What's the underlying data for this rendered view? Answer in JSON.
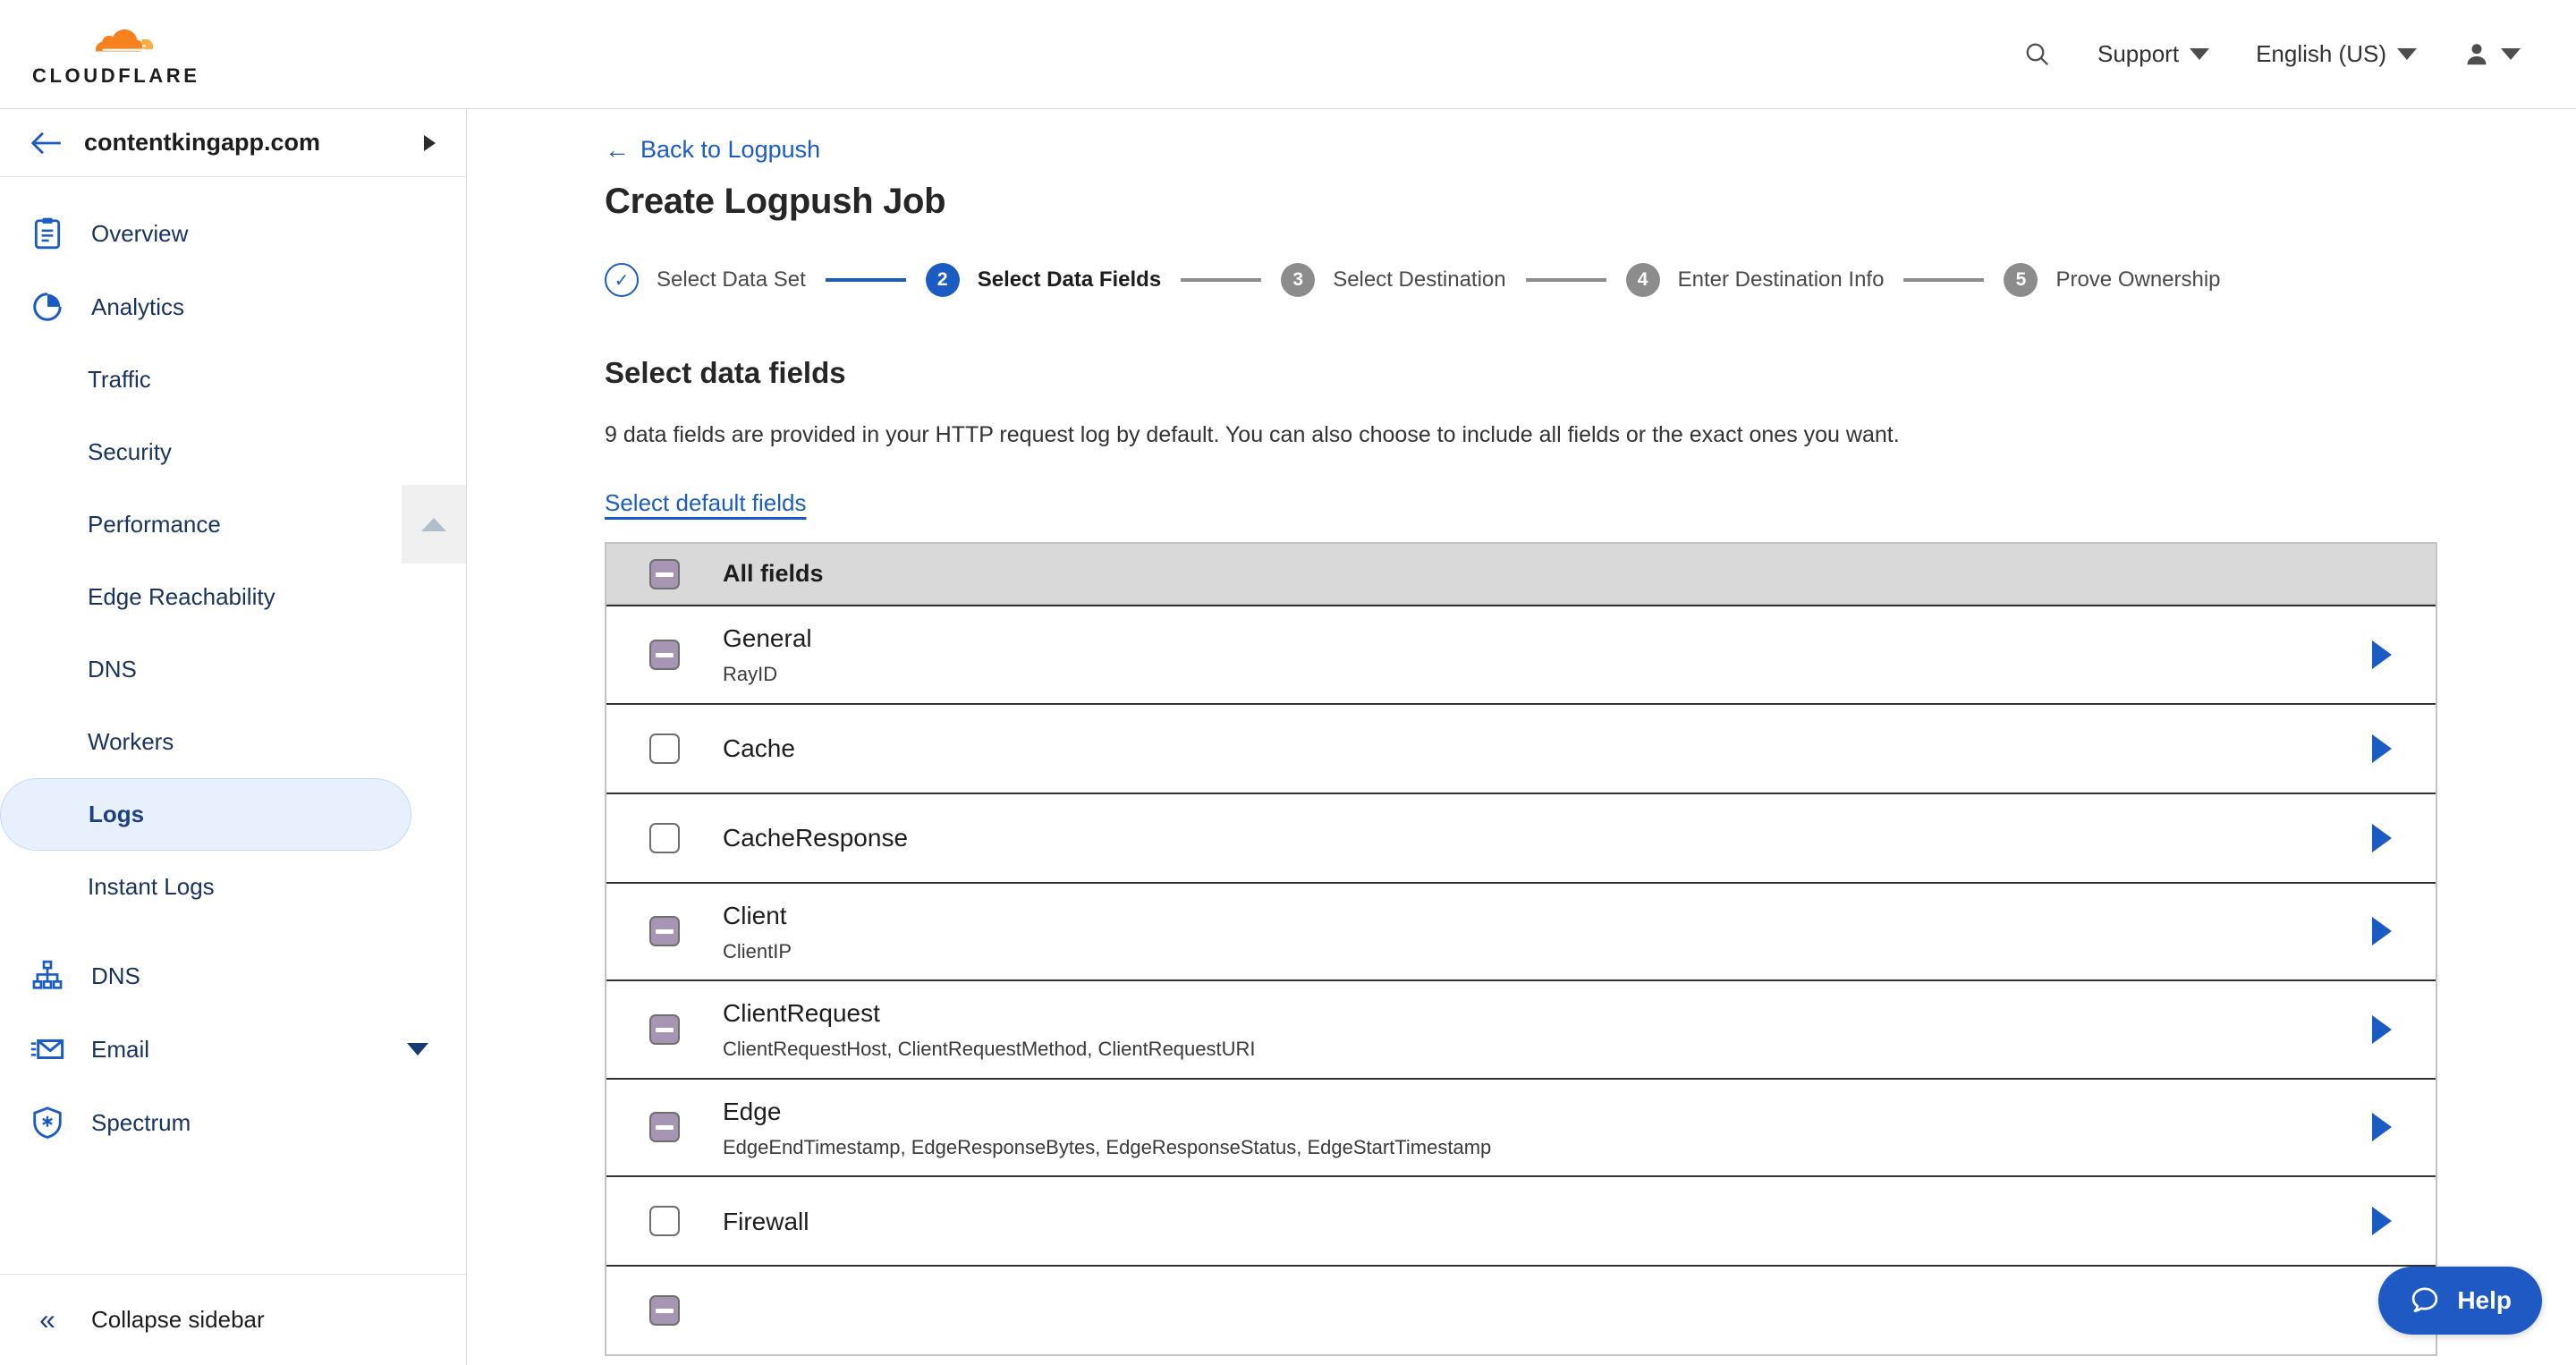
{
  "topbar": {
    "logo_text": "CLOUDFLARE",
    "search_icon": "search-icon",
    "support_label": "Support",
    "language_label": "English (US)",
    "account_icon": "user-icon"
  },
  "sidebar": {
    "zone_name": "contentkingapp.com",
    "back_icon": "back-arrow-icon",
    "items": [
      {
        "label": "Overview",
        "icon": "clipboard-icon",
        "type": "top"
      },
      {
        "label": "Analytics",
        "icon": "pie-chart-icon",
        "type": "top",
        "expanded": true
      },
      {
        "label": "Traffic",
        "type": "sub"
      },
      {
        "label": "Security",
        "type": "sub"
      },
      {
        "label": "Performance",
        "type": "sub"
      },
      {
        "label": "Edge Reachability",
        "type": "sub"
      },
      {
        "label": "DNS",
        "type": "sub"
      },
      {
        "label": "Workers",
        "type": "sub"
      },
      {
        "label": "Logs",
        "type": "sub",
        "active": true
      },
      {
        "label": "Instant Logs",
        "type": "sub"
      },
      {
        "label": "DNS",
        "icon": "sitemap-icon",
        "type": "top"
      },
      {
        "label": "Email",
        "icon": "envelope-icon",
        "type": "top",
        "has_caret": true
      },
      {
        "label": "Spectrum",
        "icon": "shield-icon",
        "type": "top"
      }
    ],
    "collapse_label": "Collapse sidebar"
  },
  "main": {
    "back_link": "Back to Logpush",
    "page_title": "Create Logpush Job",
    "steps": [
      {
        "num": "✓",
        "label": "Select Data Set",
        "state": "done"
      },
      {
        "num": "2",
        "label": "Select Data Fields",
        "state": "current"
      },
      {
        "num": "3",
        "label": "Select Destination",
        "state": "todo"
      },
      {
        "num": "4",
        "label": "Enter Destination Info",
        "state": "todo"
      },
      {
        "num": "5",
        "label": "Prove Ownership",
        "state": "todo"
      }
    ],
    "section_title": "Select data fields",
    "section_desc": "9 data fields are provided in your HTTP request log by default. You can also choose to include all fields or the exact ones you want.",
    "default_fields_link": "Select default fields",
    "table": {
      "header": {
        "label": "All fields",
        "checkbox": "indeterminate"
      },
      "rows": [
        {
          "label": "General",
          "fields": "RayID",
          "checkbox": "indeterminate",
          "expand_icon": "triangle-right-icon"
        },
        {
          "label": "Cache",
          "fields": "",
          "checkbox": "unchecked",
          "expand_icon": "triangle-right-icon"
        },
        {
          "label": "CacheResponse",
          "fields": "",
          "checkbox": "unchecked",
          "expand_icon": "triangle-right-icon"
        },
        {
          "label": "Client",
          "fields": "ClientIP",
          "checkbox": "indeterminate",
          "expand_icon": "triangle-right-icon"
        },
        {
          "label": "ClientRequest",
          "fields": "ClientRequestHost, ClientRequestMethod, ClientRequestURI",
          "checkbox": "indeterminate",
          "expand_icon": "triangle-right-icon"
        },
        {
          "label": "Edge",
          "fields": "EdgeEndTimestamp, EdgeResponseBytes, EdgeResponseStatus, EdgeStartTimestamp",
          "checkbox": "indeterminate",
          "expand_icon": "triangle-right-icon"
        },
        {
          "label": "Firewall",
          "fields": "",
          "checkbox": "unchecked",
          "expand_icon": "triangle-right-icon"
        }
      ]
    }
  },
  "help": {
    "label": "Help",
    "icon": "chat-bubble-icon"
  },
  "colors": {
    "brand_orange": "#f6821f",
    "accent_blue": "#1b5cc4",
    "nav_text": "#19335e",
    "indeterminate": "#a796b3",
    "step_todo": "#8c8c8c"
  }
}
